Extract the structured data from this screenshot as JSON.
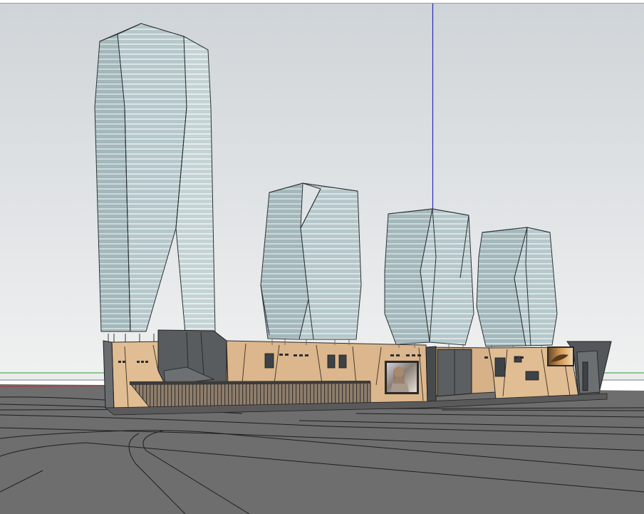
{
  "viewport": {
    "sky_top": "#cfd4d8",
    "sky_bottom": "#f0f1f1",
    "ground": "#6e6e6e",
    "glass": "#b3c6c9",
    "podium": "#e1bd93",
    "dark": "#4a4d50",
    "axis_blue": "#2a2ab8",
    "axis_green": "#3a9b3a",
    "axis_red": "#b83030"
  },
  "scene": {
    "towers": [
      {
        "name": "tower-tall"
      },
      {
        "name": "tower-mid-left"
      },
      {
        "name": "tower-mid-center"
      },
      {
        "name": "tower-mid-right"
      }
    ],
    "podium": {
      "name": "podium-building"
    },
    "screens": [
      {
        "name": "billboard-portrait"
      },
      {
        "name": "billboard-landscape"
      }
    ]
  }
}
